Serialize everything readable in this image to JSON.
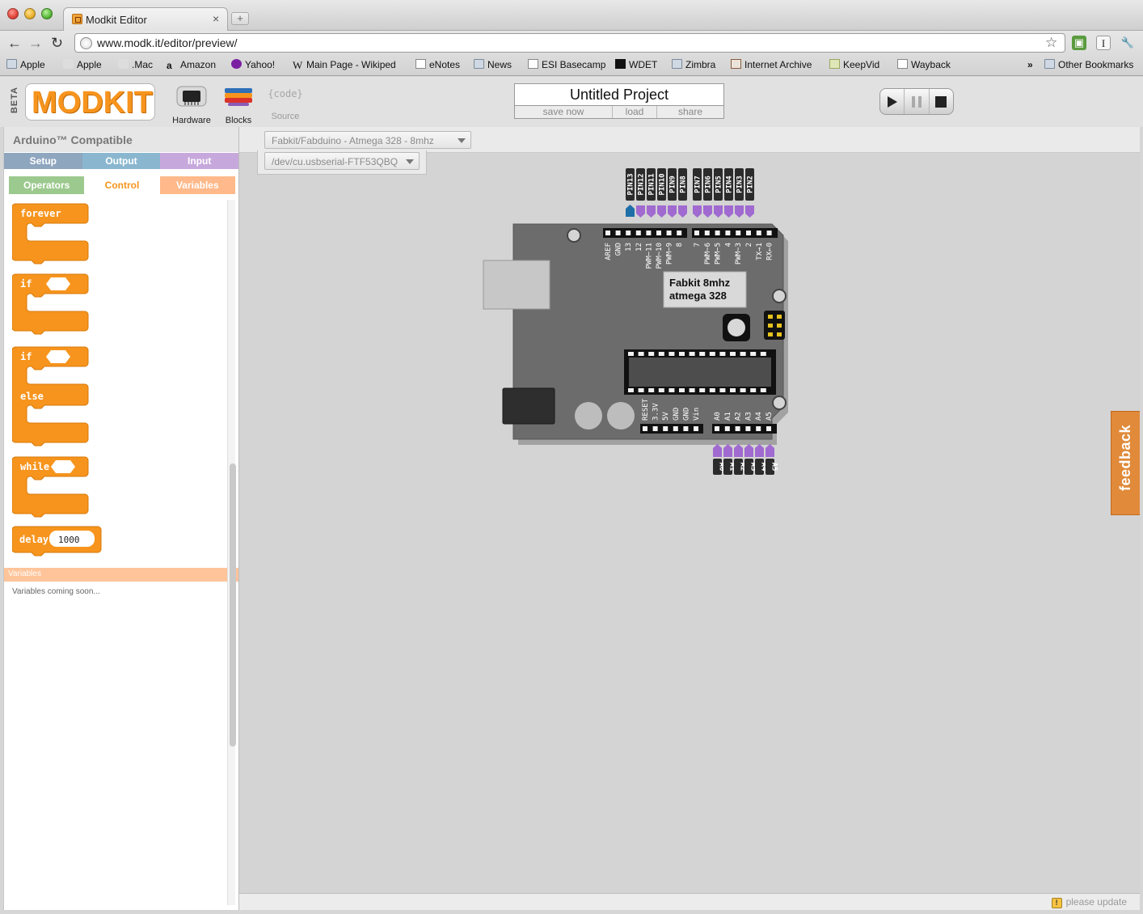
{
  "browser": {
    "tab_title": "Modkit Editor",
    "tab_close": "×",
    "new_tab": "+",
    "url": "www.modk.it/editor/preview/",
    "bookmarks": [
      {
        "label": "Apple",
        "icon": "folder-icon"
      },
      {
        "label": "Apple",
        "icon": "apple-icon"
      },
      {
        "label": ".Mac",
        "icon": "apple-icon"
      },
      {
        "label": "Amazon",
        "icon": "amazon-icon"
      },
      {
        "label": "Yahoo!",
        "icon": "yahoo-icon"
      },
      {
        "label": "Main Page - Wikiped",
        "icon": "wikipedia-icon"
      },
      {
        "label": "eNotes",
        "icon": "page-icon"
      },
      {
        "label": "News",
        "icon": "folder-icon"
      },
      {
        "label": "ESI Basecamp",
        "icon": "page-icon"
      },
      {
        "label": "WDET",
        "icon": "wdet-icon"
      },
      {
        "label": "Zimbra",
        "icon": "folder-icon"
      },
      {
        "label": "Internet Archive",
        "icon": "archive-icon"
      },
      {
        "label": "KeepVid",
        "icon": "keepvid-icon"
      },
      {
        "label": "Wayback",
        "icon": "page-icon"
      }
    ],
    "overflow": "»",
    "other_bookmarks": "Other Bookmarks"
  },
  "app": {
    "beta": "BETA",
    "logo": "MODKIT",
    "tools": [
      {
        "label": "Hardware",
        "icon": "chip-icon"
      },
      {
        "label": "Blocks",
        "icon": "blocks-icon"
      },
      {
        "label": "Source",
        "icon": "code-icon",
        "glyph": "{code}"
      }
    ],
    "project": {
      "title": "Untitled Project",
      "actions": [
        "save now",
        "load",
        "share"
      ]
    },
    "controls": [
      "play-icon",
      "pause-icon",
      "stop-icon"
    ]
  },
  "left_panel": {
    "title": "Arduino™ Compatible",
    "categories_row1": [
      {
        "label": "Setup",
        "color": "#8fa6bf"
      },
      {
        "label": "Output",
        "color": "#8ab7cf"
      },
      {
        "label": "Input",
        "color": "#c7a8dc"
      }
    ],
    "categories_row2": [
      {
        "label": "Operators",
        "color": "#9cc98e",
        "text_color": "#ffffff"
      },
      {
        "label": "Control",
        "color": "#ffffff",
        "text_color": "#f7941d"
      },
      {
        "label": "Variables",
        "color": "#ffb98a",
        "text_color": "#ffffff"
      }
    ],
    "blocks": {
      "forever": "forever",
      "if": "if",
      "if_else_if": "if",
      "else": "else",
      "while": "while",
      "delay": "delay",
      "delay_value": "1000"
    },
    "variables_header": "Variables",
    "variables_note": "Variables coming soon..."
  },
  "workspace": {
    "board_select": "Fabkit/Fabduino - Atmega 328 - 8mhz",
    "port_select": "/dev/cu.usbserial-FTF53QBQ",
    "feedback": "feedback",
    "status": "please update",
    "board": {
      "name_line1": "Fabkit 8mhz",
      "name_line2": "atmega 328",
      "top_pins": [
        "PIN13",
        "PIN12",
        "PIN11",
        "PIN10",
        "PIN9",
        "PIN8",
        "PIN7",
        "PIN6",
        "PIN5",
        "PIN4",
        "PIN3",
        "PIN2"
      ],
      "top_header_left": [
        "AREF",
        "GND",
        "13",
        "12",
        "PWM~11",
        "PWM~10",
        "PWM~9",
        "8"
      ],
      "top_header_right": [
        "7",
        "PWM~6",
        "PWM~5",
        "4",
        "PWM~3",
        "2",
        "TX→1",
        "RX←0"
      ],
      "power_header": [
        "RESET",
        "3.3V",
        "5V",
        "GND",
        "GND",
        "Vin"
      ],
      "analog_header": [
        "A0",
        "A1",
        "A2",
        "A3",
        "A4",
        "A5"
      ],
      "bottom_pins": [
        "A0",
        "A1",
        "A2",
        "A3",
        "A4",
        "A5"
      ],
      "colors": {
        "board": "#6c6c6c",
        "pin_purple": "#a06ad0",
        "pin_active": "#1e6fa8",
        "tag": "#2b2b2b"
      }
    }
  },
  "colors": {
    "accent": "#f7941d",
    "block": "#f7941d"
  }
}
